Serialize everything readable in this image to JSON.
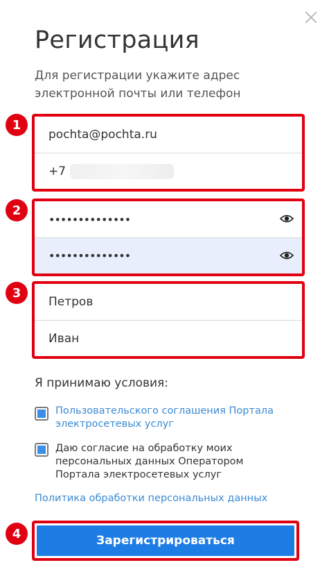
{
  "dialog": {
    "title": "Регистрация",
    "subtitle": "Для регистрации укажите адрес электронной почты или телефон"
  },
  "form": {
    "email": "pochta@pochta.ru",
    "phone_prefix": "+7",
    "password": "••••••••••••••",
    "password_confirm": "••••••••••••••",
    "last_name": "Петров",
    "first_name": "Иван"
  },
  "badges": [
    "1",
    "2",
    "3",
    "4"
  ],
  "terms": {
    "title": "Я принимаю условия:",
    "agreement": "Пользовательского соглашения Портала электросетевых услуг",
    "consent": "Даю согласие на обработку моих персональных данных Оператором Портала электросетевых услуг",
    "policy_link": "Политика обработки персональных данных"
  },
  "submit_label": "Зарегистрироваться",
  "colors": {
    "highlight": "#e00012",
    "accent": "#1e7de5",
    "link": "#3a8bd3"
  }
}
